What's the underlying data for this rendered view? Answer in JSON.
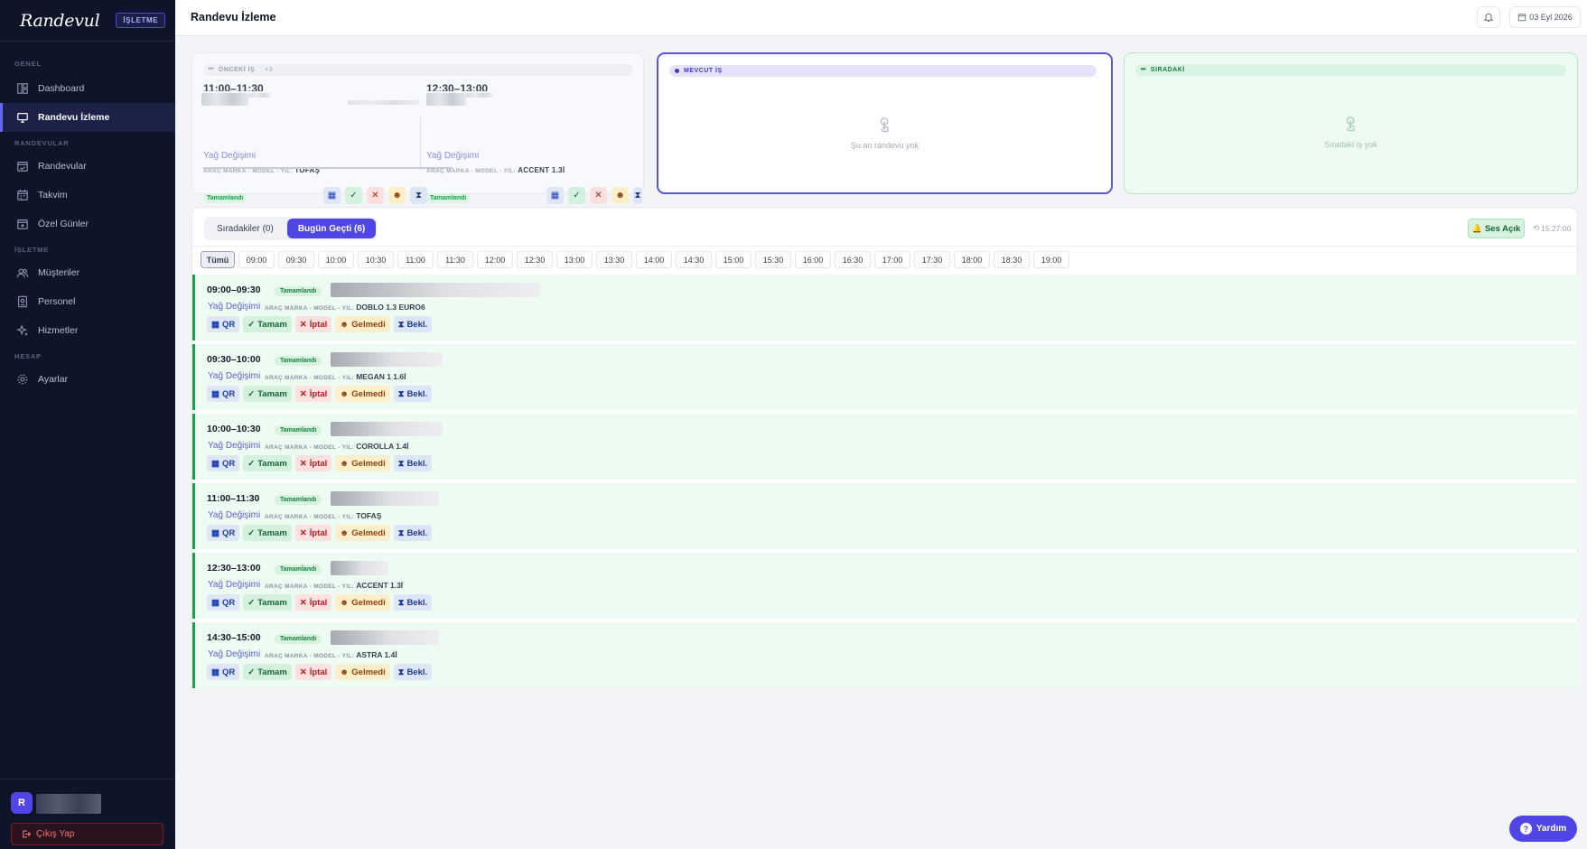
{
  "sidebar": {
    "logo": "Randevul",
    "badge": "İŞLETME",
    "sections": [
      "GENEL",
      "RANDEVULAR",
      "İŞLETME",
      "HESAP"
    ],
    "items": [
      {
        "label": "Dashboard",
        "icon": "dashboard-icon"
      },
      {
        "label": "Randevu İzleme",
        "icon": "monitor-icon",
        "active": true
      },
      {
        "label": "Randevular",
        "icon": "calendar-check-icon"
      },
      {
        "label": "Takvim",
        "icon": "calendar-icon"
      },
      {
        "label": "Özel Günler",
        "icon": "calendar-plus-icon"
      },
      {
        "label": "Müşteriler",
        "icon": "users-icon"
      },
      {
        "label": "Personel",
        "icon": "badge-icon"
      },
      {
        "label": "Hizmetler",
        "icon": "sparkle-icon"
      },
      {
        "label": "Ayarlar",
        "icon": "gear-icon"
      }
    ],
    "user_initial": "R",
    "logout": "Çıkış Yap"
  },
  "header": {
    "title": "Randevu İzleme",
    "date": "03 Eyl 2026"
  },
  "cards": {
    "previous": {
      "label": "ÖNCEKİ İŞ",
      "extra": "+3",
      "slots": [
        {
          "time": "11:00–11:30",
          "service": "Yağ Değişimi",
          "car_label": "ARAÇ MARKA - MODEL - YIL:",
          "car": "TOFAŞ",
          "status": "Tamamlandı"
        },
        {
          "time": "12:30–13:00",
          "service": "Yağ Değişimi",
          "car_label": "ARAÇ MARKA - MODEL - YIL:",
          "car": "ACCENT 1.3İ",
          "status": "Tamamlandı"
        }
      ]
    },
    "current": {
      "label": "MEVCUT İŞ",
      "empty": "Şu an randevu yok"
    },
    "next": {
      "label": "SIRADAKİ",
      "empty": "Sıradaki iş yok"
    }
  },
  "panel": {
    "tabs": [
      "Sıradakiler (0)",
      "Bugün Geçti (6)"
    ],
    "active_tab": 1,
    "sound": "Ses Açık",
    "clock": "15:27:00",
    "filters": [
      "Tümü",
      "09:00",
      "09:30",
      "10:00",
      "10:30",
      "11:00",
      "11:30",
      "12:00",
      "12:30",
      "13:00",
      "13:30",
      "14:00",
      "14:30",
      "15:00",
      "15:30",
      "16:00",
      "16:30",
      "17:00",
      "17:30",
      "18:00",
      "18:30",
      "19:00"
    ],
    "car_label": "ARAÇ MARKA - MODEL - YIL:",
    "actions": {
      "qr": "QR",
      "done": "Tamam",
      "cancel": "İptal",
      "noshow": "Gelmedi",
      "wait": "Bekl."
    },
    "rows": [
      {
        "time": "09:00–09:30",
        "status": "Tamamlandı",
        "service": "Yağ Değişimi",
        "car": "DOBLO 1.3 EURO6"
      },
      {
        "time": "09:30–10:00",
        "status": "Tamamlandı",
        "service": "Yağ Değişimi",
        "car": "MEGAN 1 1.6İ"
      },
      {
        "time": "10:00–10:30",
        "status": "Tamamlandı",
        "service": "Yağ Değişimi",
        "car": "COROLLA 1.4İ"
      },
      {
        "time": "11:00–11:30",
        "status": "Tamamlandı",
        "service": "Yağ Değişimi",
        "car": "TOFAŞ"
      },
      {
        "time": "12:30–13:00",
        "status": "Tamamlandı",
        "service": "Yağ Değişimi",
        "car": "ACCENT 1.3İ"
      },
      {
        "time": "14:30–15:00",
        "status": "Tamamlandı",
        "service": "Yağ Değişimi",
        "car": "ASTRA 1.4İ"
      }
    ]
  },
  "help": "Yardım",
  "colors": {
    "accent": "#4f46e5",
    "success": "#16a34a",
    "sidebar": "#0f1528"
  }
}
